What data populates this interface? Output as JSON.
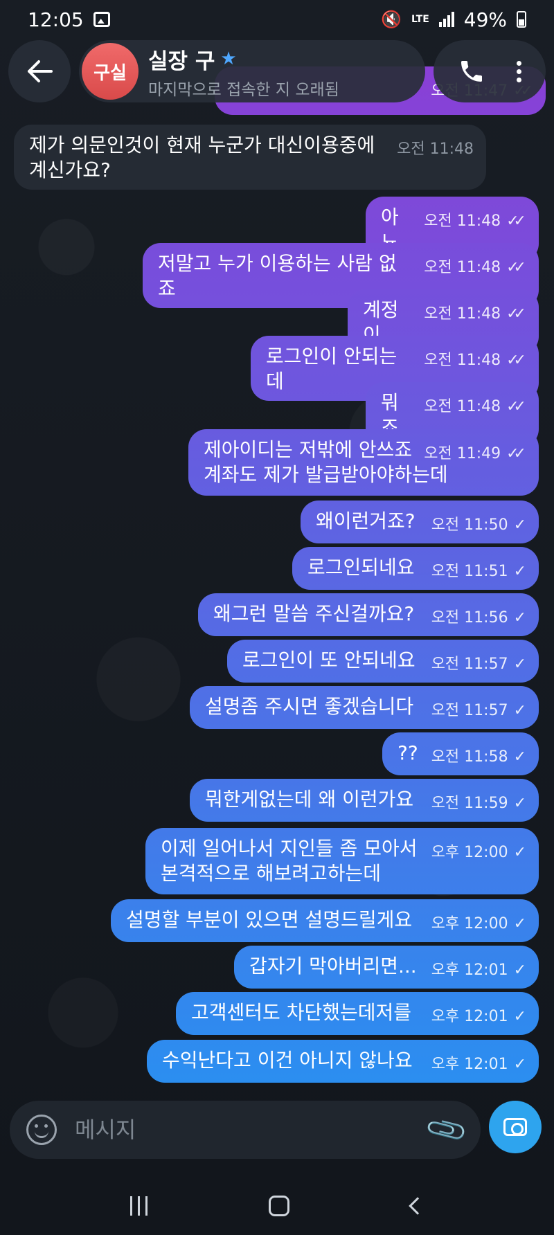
{
  "status_bar": {
    "time": "12:05",
    "network": "LTE",
    "battery": "49%"
  },
  "header": {
    "avatar_initials": "구실",
    "contact_name": "실장 구",
    "last_seen": "마지막으로 접속한 지 오래됨"
  },
  "messages": [
    {
      "dir": "out",
      "text": "",
      "time": "오전 11:47",
      "status": "read"
    },
    {
      "dir": "in",
      "text": "제가 의문인것이 현재 누군가 대신이용중에 계신가요?",
      "time": "오전 11:48"
    },
    {
      "dir": "out",
      "text": "아뇨",
      "time": "오전 11:48",
      "status": "read"
    },
    {
      "dir": "out",
      "text": "저말고 누가 이용하는 사람 없죠",
      "time": "오전 11:48",
      "status": "read"
    },
    {
      "dir": "out",
      "text": "계정이",
      "time": "오전 11:48",
      "status": "read"
    },
    {
      "dir": "out",
      "text": "로그인이 안되는데",
      "time": "오전 11:48",
      "status": "read"
    },
    {
      "dir": "out",
      "text": "뭐죠",
      "time": "오전 11:48",
      "status": "read"
    },
    {
      "dir": "out",
      "text": "제아이디는 저밖에 안쓰죠 계좌도 제가 발급받아야하는데",
      "time": "오전 11:49",
      "status": "read"
    },
    {
      "dir": "out",
      "text": "왜이런거죠?",
      "time": "오전 11:50",
      "status": "sent"
    },
    {
      "dir": "out",
      "text": "로그인되네요",
      "time": "오전 11:51",
      "status": "sent"
    },
    {
      "dir": "out",
      "text": "왜그런 말씀 주신걸까요?",
      "time": "오전 11:56",
      "status": "sent"
    },
    {
      "dir": "out",
      "text": "로그인이 또 안되네요",
      "time": "오전 11:57",
      "status": "sent"
    },
    {
      "dir": "out",
      "text": "설명좀 주시면 좋겠습니다",
      "time": "오전 11:57",
      "status": "sent"
    },
    {
      "dir": "out",
      "text": "??",
      "time": "오전 11:58",
      "status": "sent"
    },
    {
      "dir": "out",
      "text": "뭐한게없는데 왜 이런가요",
      "time": "오전 11:59",
      "status": "sent"
    },
    {
      "dir": "out",
      "text": "이제 일어나서 지인들 좀 모아서 본격적으로 해보려고하는데",
      "time": "오후 12:00",
      "status": "sent"
    },
    {
      "dir": "out",
      "text": "설명할 부분이 있으면 설명드릴게요",
      "time": "오후 12:00",
      "status": "sent"
    },
    {
      "dir": "out",
      "text": "갑자기 막아버리면...",
      "time": "오후 12:01",
      "status": "sent"
    },
    {
      "dir": "out",
      "text": "고객센터도 차단했는데저를",
      "time": "오후 12:01",
      "status": "sent"
    },
    {
      "dir": "out",
      "text": "수익난다고 이건 아니지 않나요",
      "time": "오후 12:01",
      "status": "sent"
    }
  ],
  "input": {
    "placeholder": "메시지"
  },
  "colors": {
    "bubble_top": "#8a3fd6",
    "bubble_bottom": "#2b8ef0",
    "incoming_bubble": "#252b34",
    "accent": "#2ea4ee"
  }
}
